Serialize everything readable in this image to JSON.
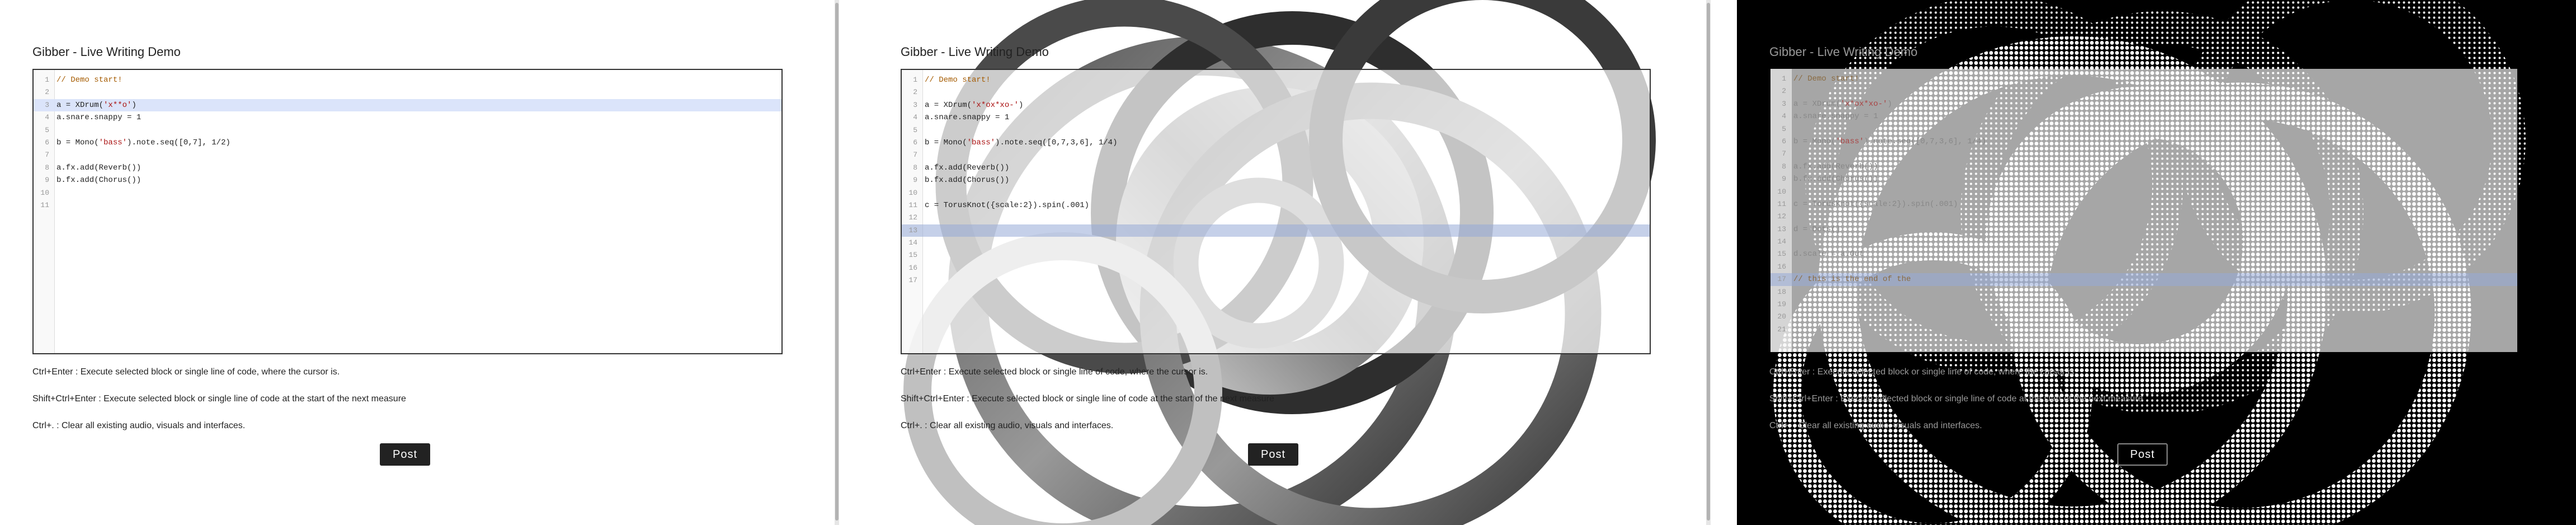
{
  "title": "Gibber - Live Writing Demo",
  "post_label": "Post",
  "instructions": [
    "Ctrl+Enter : Execute selected block or single line of code, where the cursor is.",
    "Shift+Ctrl+Enter : Execute selected block or single line of code at the start of the next measure",
    "Ctrl+. : Clear all existing audio, visuals and interfaces."
  ],
  "panels": [
    {
      "lines": [
        {
          "n": "1",
          "parts": [
            {
              "t": "// Demo start!",
              "c": "cm"
            }
          ]
        },
        {
          "n": "2",
          "parts": []
        },
        {
          "n": "3",
          "parts": [
            {
              "t": "a = XDrum("
            },
            {
              "t": "'x**o'",
              "c": "str"
            },
            {
              "t": ")"
            }
          ]
        },
        {
          "n": "4",
          "parts": [
            {
              "t": "a.snare.snappy = 1"
            }
          ]
        },
        {
          "n": "5",
          "parts": []
        },
        {
          "n": "6",
          "parts": [
            {
              "t": "b = Mono("
            },
            {
              "t": "'bass'",
              "c": "str"
            },
            {
              "t": ").note.seq([0,7], 1/2)"
            }
          ]
        },
        {
          "n": "7",
          "parts": []
        },
        {
          "n": "8",
          "parts": [
            {
              "t": "a.fx.add(Reverb())"
            }
          ]
        },
        {
          "n": "9",
          "parts": [
            {
              "t": "b.fx.add(Chorus())"
            }
          ]
        },
        {
          "n": "10",
          "parts": []
        },
        {
          "n": "11",
          "parts": []
        }
      ]
    },
    {
      "lines": [
        {
          "n": "1",
          "parts": [
            {
              "t": "// Demo start!",
              "c": "cm"
            }
          ]
        },
        {
          "n": "2",
          "parts": []
        },
        {
          "n": "3",
          "parts": [
            {
              "t": "a = XDrum("
            },
            {
              "t": "'x*ox*xo-'",
              "c": "str"
            },
            {
              "t": ")"
            }
          ]
        },
        {
          "n": "4",
          "parts": [
            {
              "t": "a.snare.snappy = 1"
            }
          ]
        },
        {
          "n": "5",
          "parts": []
        },
        {
          "n": "6",
          "parts": [
            {
              "t": "b = Mono("
            },
            {
              "t": "'bass'",
              "c": "str"
            },
            {
              "t": ").note.seq([0,7,3,6], 1/4)"
            }
          ]
        },
        {
          "n": "7",
          "parts": []
        },
        {
          "n": "8",
          "parts": [
            {
              "t": "a.fx.add(Reverb())"
            }
          ]
        },
        {
          "n": "9",
          "parts": [
            {
              "t": "b.fx.add(Chorus())"
            }
          ]
        },
        {
          "n": "10",
          "parts": []
        },
        {
          "n": "11",
          "parts": [
            {
              "t": "c = TorusKnot({scale:2}).spin(.001)"
            }
          ]
        },
        {
          "n": "12",
          "parts": []
        },
        {
          "n": "13",
          "parts": []
        },
        {
          "n": "14",
          "parts": []
        },
        {
          "n": "15",
          "parts": []
        },
        {
          "n": "16",
          "parts": []
        },
        {
          "n": "17",
          "parts": []
        }
      ]
    },
    {
      "lines": [
        {
          "n": "1",
          "parts": [
            {
              "t": "// Demo start!",
              "c": "cm"
            }
          ]
        },
        {
          "n": "2",
          "parts": []
        },
        {
          "n": "3",
          "parts": [
            {
              "t": "a = XDrum("
            },
            {
              "t": "'x*ox*xo-'",
              "c": "str"
            },
            {
              "t": ")"
            }
          ]
        },
        {
          "n": "4",
          "parts": [
            {
              "t": "a.snare.snappy = 1"
            }
          ]
        },
        {
          "n": "5",
          "parts": []
        },
        {
          "n": "6",
          "parts": [
            {
              "t": "b = Mono("
            },
            {
              "t": "'bass'",
              "c": "str"
            },
            {
              "t": ").note.seq([0,7,3,6], 1/4)"
            }
          ]
        },
        {
          "n": "7",
          "parts": []
        },
        {
          "n": "8",
          "parts": [
            {
              "t": "a.fx.add(Reverb())"
            }
          ]
        },
        {
          "n": "9",
          "parts": [
            {
              "t": "b.fx.add(Chorus())"
            }
          ]
        },
        {
          "n": "10",
          "parts": []
        },
        {
          "n": "11",
          "parts": [
            {
              "t": "c = TorusKnot({scale:2}).spin(.001)"
            }
          ]
        },
        {
          "n": "12",
          "parts": []
        },
        {
          "n": "13",
          "parts": [
            {
              "t": "d = Dots()"
            }
          ]
        },
        {
          "n": "14",
          "parts": []
        },
        {
          "n": "15",
          "parts": [
            {
              "t": "d.scale = a.Out"
            }
          ]
        },
        {
          "n": "16",
          "parts": []
        },
        {
          "n": "17",
          "parts": [
            {
              "t": "// this is the end of the ",
              "c": "cm"
            }
          ]
        },
        {
          "n": "18",
          "parts": []
        },
        {
          "n": "19",
          "parts": []
        },
        {
          "n": "20",
          "parts": []
        },
        {
          "n": "21",
          "parts": []
        }
      ]
    }
  ],
  "icons": [
    "torus-knot-graphic",
    "halftone-dots-graphic",
    "scrollbar-thumb"
  ],
  "colors": {
    "button_bg": "#222222",
    "comment": "#a55b00",
    "string": "#aa1111",
    "active_line": "#d7e1fa"
  }
}
